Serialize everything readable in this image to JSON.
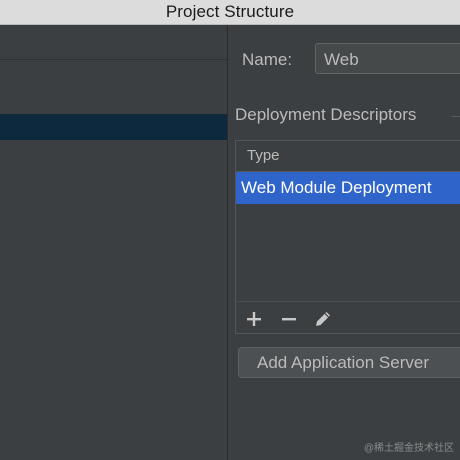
{
  "window": {
    "title": "Project Structure"
  },
  "form": {
    "name_label": "Name:",
    "name_value": "Web"
  },
  "deployment_descriptors": {
    "section_title": "Deployment Descriptors",
    "column_header": "Type",
    "rows": [
      {
        "label": "Web Module Deployment",
        "selected": true
      }
    ],
    "toolbar": {
      "add_icon": "plus-icon",
      "remove_icon": "minus-icon",
      "edit_icon": "pencil-icon"
    }
  },
  "actions": {
    "add_server_label": "Add Application Server"
  },
  "watermark": {
    "text": "@稀土掘金技术社区"
  },
  "colors": {
    "background": "#3c3f41",
    "tree_selection": "#0d293e",
    "row_selection": "#2f65ca",
    "text": "#bbbbbb"
  }
}
